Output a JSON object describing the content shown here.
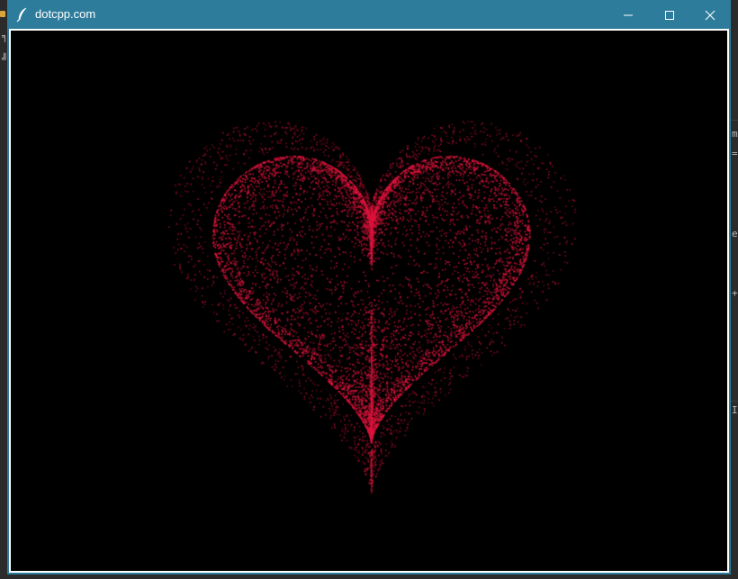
{
  "window": {
    "title": "dotcpp.com",
    "app_icon": "feather-icon",
    "controls": {
      "minimize_icon": "minimize-icon",
      "maximize_icon": "maximize-icon",
      "close_icon": "close-icon"
    },
    "titlebar_color": "#2e7c9b"
  },
  "canvas": {
    "background_color": "#000000",
    "heart_color": "#dc143c"
  }
}
